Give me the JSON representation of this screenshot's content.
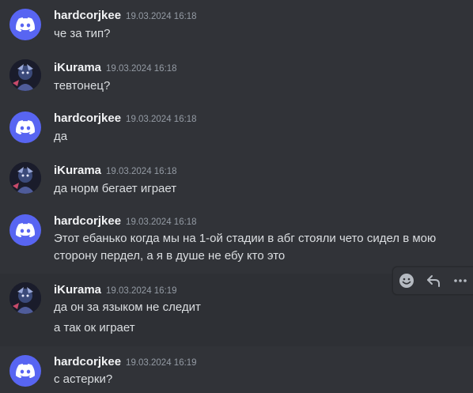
{
  "messages": [
    {
      "author": "hardcorjkee",
      "timestamp": "19.03.2024 16:18",
      "lines": [
        "че за тип?"
      ],
      "avatar": "discord-logo-icon"
    },
    {
      "author": "iKurama",
      "timestamp": "19.03.2024 16:18",
      "lines": [
        "тевтонец?"
      ],
      "avatar": "anime-avatar"
    },
    {
      "author": "hardcorjkee",
      "timestamp": "19.03.2024 16:18",
      "lines": [
        "да"
      ],
      "avatar": "discord-logo-icon"
    },
    {
      "author": "iKurama",
      "timestamp": "19.03.2024 16:18",
      "lines": [
        "да норм бегает играет"
      ],
      "avatar": "anime-avatar"
    },
    {
      "author": "hardcorjkee",
      "timestamp": "19.03.2024 16:18",
      "lines": [
        "Этот ебанько когда мы на 1-ой стадии в абг стояли чето сидел в мою",
        "сторону пердел, а я в душе не ебу кто это"
      ],
      "avatar": "discord-logo-icon"
    },
    {
      "author": "iKurama",
      "timestamp": "19.03.2024 16:19",
      "lines": [
        "да он за языком не следит",
        "а так ок играет"
      ],
      "avatar": "anime-avatar"
    },
    {
      "author": "hardcorjkee",
      "timestamp": "19.03.2024 16:19",
      "lines": [
        "с астерки?"
      ],
      "avatar": "discord-logo-icon"
    }
  ],
  "toolbar": {
    "icons": [
      "add-reaction-icon",
      "reply-icon",
      "more-icon"
    ]
  },
  "colors": {
    "background": "#313338",
    "hover_background": "#2e3035",
    "username": "#f2f3f5",
    "timestamp": "#949ba4",
    "text": "#dbdee1",
    "discord_blurple": "#5865f2"
  }
}
